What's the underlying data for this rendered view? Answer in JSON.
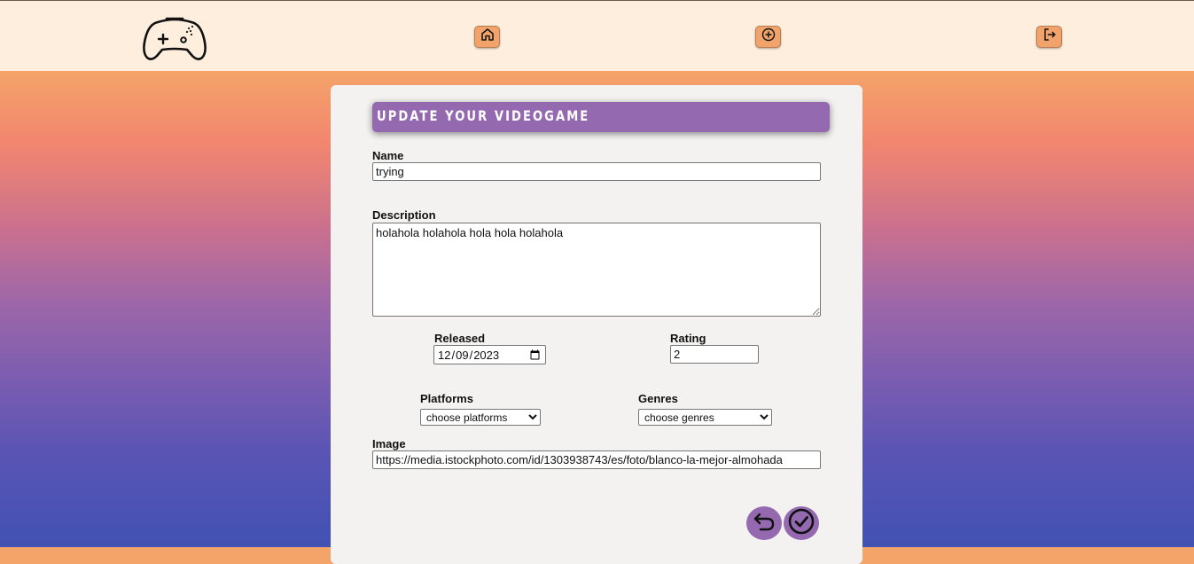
{
  "nav": {
    "logo_icon": "gamepad-icon",
    "buttons": [
      {
        "icon": "home-icon"
      },
      {
        "icon": "plus-circle-icon"
      },
      {
        "icon": "logout-icon"
      }
    ],
    "button_color": "#f1a36b",
    "bar_color": "#fdeedd"
  },
  "form": {
    "title": "Update your videogame",
    "title_color": "#9469b0",
    "name_label": "Name",
    "name_value": "trying",
    "description_label": "Description",
    "description_value": "holahola holahola hola hola holahola",
    "released_label": "Released",
    "released_value": "2023-12-09",
    "rating_label": "Rating",
    "rating_value": "2",
    "platforms_label": "Platforms",
    "platforms_selected": "choose platforms",
    "genres_label": "Genres",
    "genres_selected": "choose genres",
    "image_label": "Image",
    "image_value": "https://media.istockphoto.com/id/1303938743/es/foto/blanco-la-mejor-almohada"
  },
  "actions": {
    "back_icon": "undo-arrow-icon",
    "submit_icon": "check-circle-icon"
  }
}
